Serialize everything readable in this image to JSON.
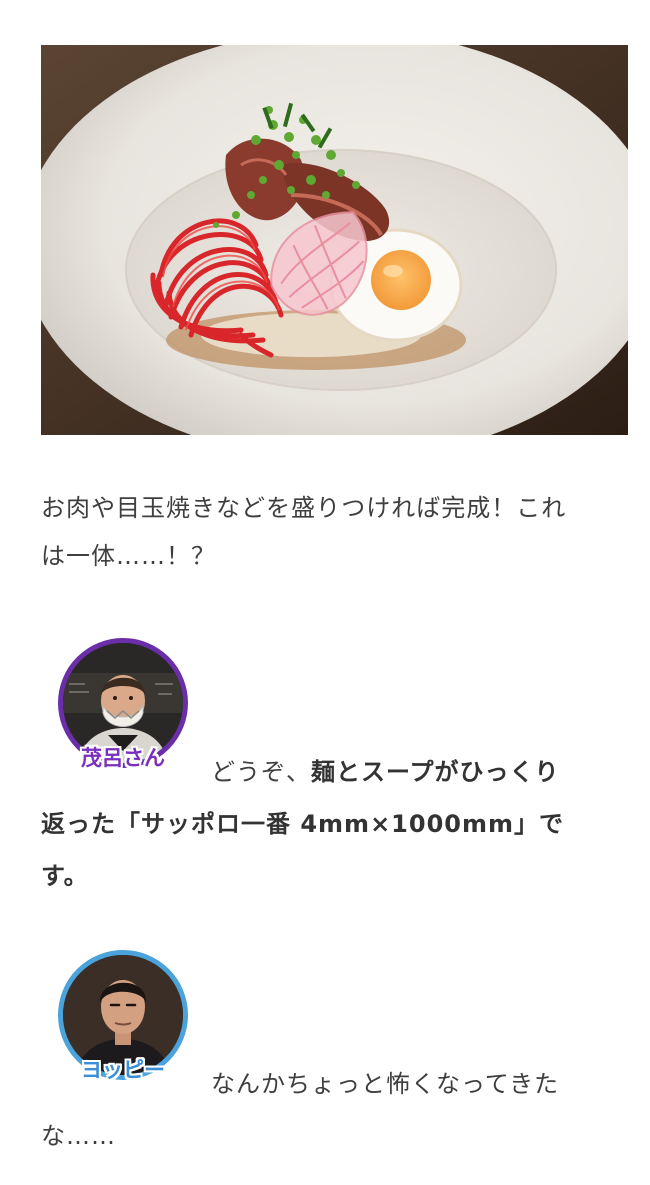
{
  "photo": {
    "alt_subject": "dish-photo"
  },
  "intro": {
    "line1": "お肉や目玉焼きなどを盛りつければ完成！これ",
    "line2": "は一体……！？"
  },
  "speaker1": {
    "name": "茂呂さん",
    "text_plain_1": "どうぞ、",
    "text_bold_1": "麺とスープがひっくり",
    "text_bold_2": "返った「サッポロ一番 4mm×1000mm」で",
    "text_bold_3": "す。",
    "ring_color": "#6a2fa8",
    "name_color": "#7b2fbd"
  },
  "speaker2": {
    "name": "ヨッピー",
    "text_1": "なんかちょっと怖くなってきた",
    "text_2": "な……",
    "ring_color": "#4ba3dc",
    "name_color": "#3a8fd6"
  },
  "colors": {
    "text": "#3f3f3f",
    "background": "#ffffff"
  }
}
